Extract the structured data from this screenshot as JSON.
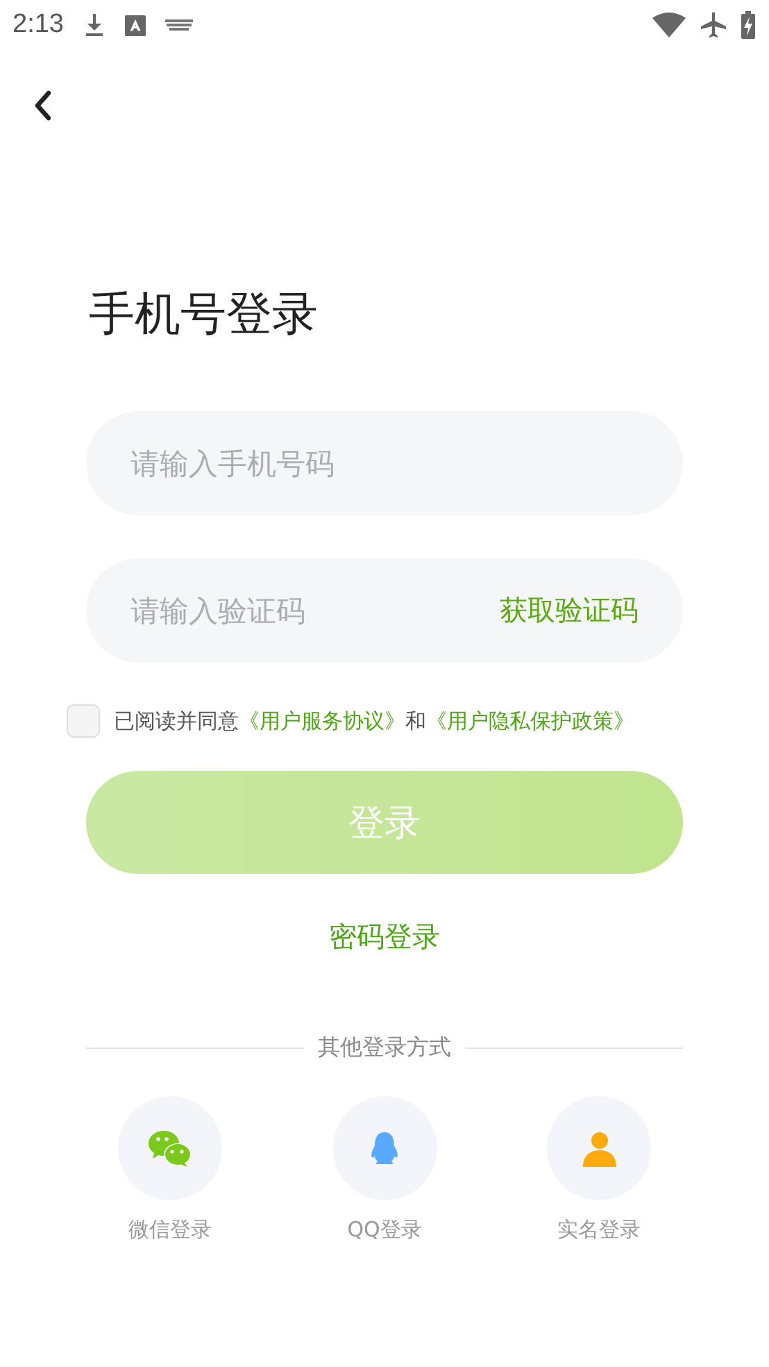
{
  "status_bar": {
    "time": "2:13"
  },
  "title": "手机号登录",
  "phone_field": {
    "placeholder": "请输入手机号码"
  },
  "code_field": {
    "placeholder": "请输入验证码",
    "action": "获取验证码"
  },
  "agreement": {
    "checked": false,
    "parts": [
      {
        "kind": "text",
        "text": "已阅读并同意"
      },
      {
        "kind": "link",
        "text": "《用户服务协议》"
      },
      {
        "kind": "text",
        "text": "和"
      },
      {
        "kind": "link",
        "text": "《用户隐私保护政策》"
      }
    ]
  },
  "login_button": {
    "label": "登录",
    "disabled": true
  },
  "password_login": "密码登录",
  "other_methods": {
    "heading": "其他登录方式",
    "items": [
      {
        "kind": "wechat",
        "label": "微信登录"
      },
      {
        "kind": "qq",
        "label": "QQ登录"
      },
      {
        "kind": "person",
        "label": "实名登录"
      }
    ]
  }
}
